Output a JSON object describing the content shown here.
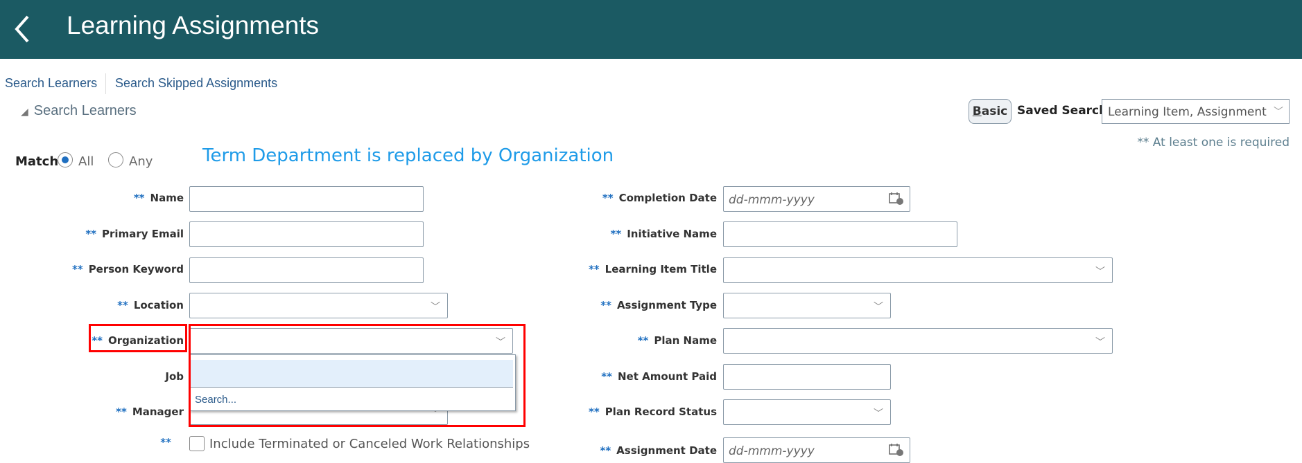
{
  "header": {
    "title": "Learning Assignments",
    "back_icon": "chevron-left-icon"
  },
  "tabs": [
    "Search Learners",
    "Search Skipped Assignments"
  ],
  "section": {
    "title": "Search Learners"
  },
  "toolbar": {
    "basic_label": "Basic",
    "basic_accesskey": "B",
    "basic_rest": "asic",
    "saved_search_label": "Saved Search",
    "saved_search_value": "Learning Item, Assignment"
  },
  "required_note": "** At least one is required",
  "match": {
    "label": "Match",
    "options": [
      "All",
      "Any"
    ],
    "selected": "All"
  },
  "annotation": "Term Department is replaced by Organization",
  "req_mark": "**",
  "left_fields": [
    {
      "label": "Name",
      "required": true,
      "type": "text"
    },
    {
      "label": "Primary Email",
      "required": true,
      "type": "text"
    },
    {
      "label": "Person Keyword",
      "required": true,
      "type": "text"
    },
    {
      "label": "Location",
      "required": true,
      "type": "select"
    },
    {
      "label": "Organization",
      "required": true,
      "type": "select"
    },
    {
      "label": "Job",
      "required": false,
      "type": "select"
    },
    {
      "label": "Manager",
      "required": true,
      "type": "select"
    }
  ],
  "checkbox": {
    "label": "Include Terminated or Canceled Work Relationships",
    "checked": false
  },
  "dropdown": {
    "search_label": "Search..."
  },
  "right_fields": [
    {
      "label": "Completion Date",
      "placeholder": "dd-mmm-yyyy",
      "type": "date"
    },
    {
      "label": "Initiative Name",
      "type": "text"
    },
    {
      "label": "Learning Item Title",
      "type": "select"
    },
    {
      "label": "Assignment Type",
      "type": "select"
    },
    {
      "label": "Plan Name",
      "type": "select"
    },
    {
      "label": "Net Amount Paid",
      "type": "text"
    },
    {
      "label": "Plan Record Status",
      "type": "select"
    },
    {
      "label": "Assignment Date",
      "placeholder": "dd-mmm-yyyy",
      "type": "date"
    }
  ],
  "colors": {
    "header": "#1b5a63",
    "accent": "#1f6fc0",
    "annotation": "#1e9be8",
    "highlight": "#ff0000"
  }
}
